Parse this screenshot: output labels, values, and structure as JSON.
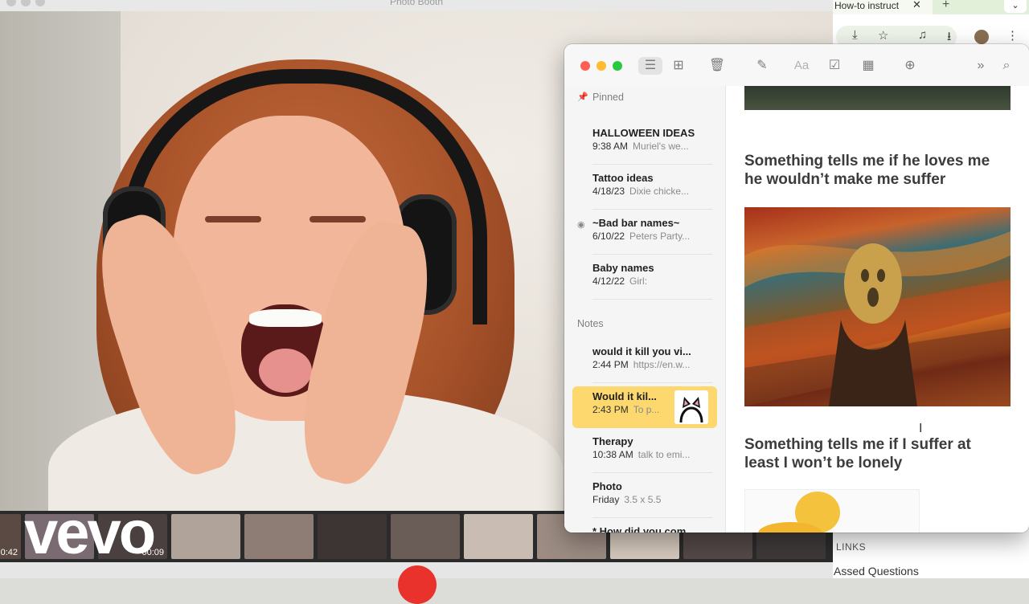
{
  "photobooth": {
    "window_title": "Photo Booth",
    "brand_watermark": "vevo",
    "filmstrip": [
      {
        "time": "0:42",
        "color": "#5b4a44"
      },
      {
        "time": "",
        "color": "#7a6a72"
      },
      {
        "time": "00:09",
        "color": "#4a4040"
      },
      {
        "time": "",
        "color": "#b0a39a"
      },
      {
        "time": "",
        "color": "#8d7d74"
      },
      {
        "time": "",
        "color": "#3d3534"
      },
      {
        "time": "",
        "color": "#6a5d57"
      },
      {
        "time": "",
        "color": "#c9bdb3"
      },
      {
        "time": "",
        "color": "#9c8c83"
      },
      {
        "time": "",
        "color": "#d4c8bd"
      },
      {
        "time": "",
        "color": "#544848"
      },
      {
        "time": "",
        "color": "#3f3a39"
      }
    ]
  },
  "chrome": {
    "tab_title": "How-to instruct",
    "tab_close": "✕",
    "tab_add": "+",
    "tab_dropdown": "⌄",
    "section_label": "LINKS",
    "link_text": "Assed Questions"
  },
  "notes": {
    "sidebar": {
      "pinned_label": "Pinned",
      "notes_label": "Notes",
      "pinned": [
        {
          "title": "HALLOWEEN IDEAS",
          "date": "9:38 AM",
          "preview": "Muriel's we...",
          "shared": false
        },
        {
          "title": "Tattoo ideas",
          "date": "4/18/23",
          "preview": "Dixie chicke...",
          "shared": false
        },
        {
          "title": "~Bad bar names~",
          "date": "6/10/22",
          "preview": "Peters Party...",
          "shared": true
        },
        {
          "title": "Baby names",
          "date": "4/12/22",
          "preview": "Girl:",
          "shared": false
        }
      ],
      "notes": [
        {
          "title": "would it kill you vi...",
          "date": "2:44 PM",
          "preview": "https://en.w...",
          "selected": false
        },
        {
          "title": "Would it kil...",
          "date": "2:43 PM",
          "preview": "To p...",
          "selected": true
        },
        {
          "title": "Therapy",
          "date": "10:38 AM",
          "preview": "talk to emi...",
          "selected": false
        },
        {
          "title": "Photo",
          "date": "Friday",
          "preview": "3.5 x 5.5",
          "selected": false
        },
        {
          "title": "* How did you com...",
          "date": "",
          "preview": "",
          "selected": false
        }
      ]
    },
    "content": {
      "headline_1": "Something tells me if he loves me he wouldn’t make me suffer",
      "headline_2": "Something tells me if I suffer at least I won’t be lonely"
    },
    "colors": {
      "selected_note": "#fcd86f",
      "close": "#ff5f57",
      "minimize": "#febc2e",
      "zoom": "#28c840"
    }
  }
}
